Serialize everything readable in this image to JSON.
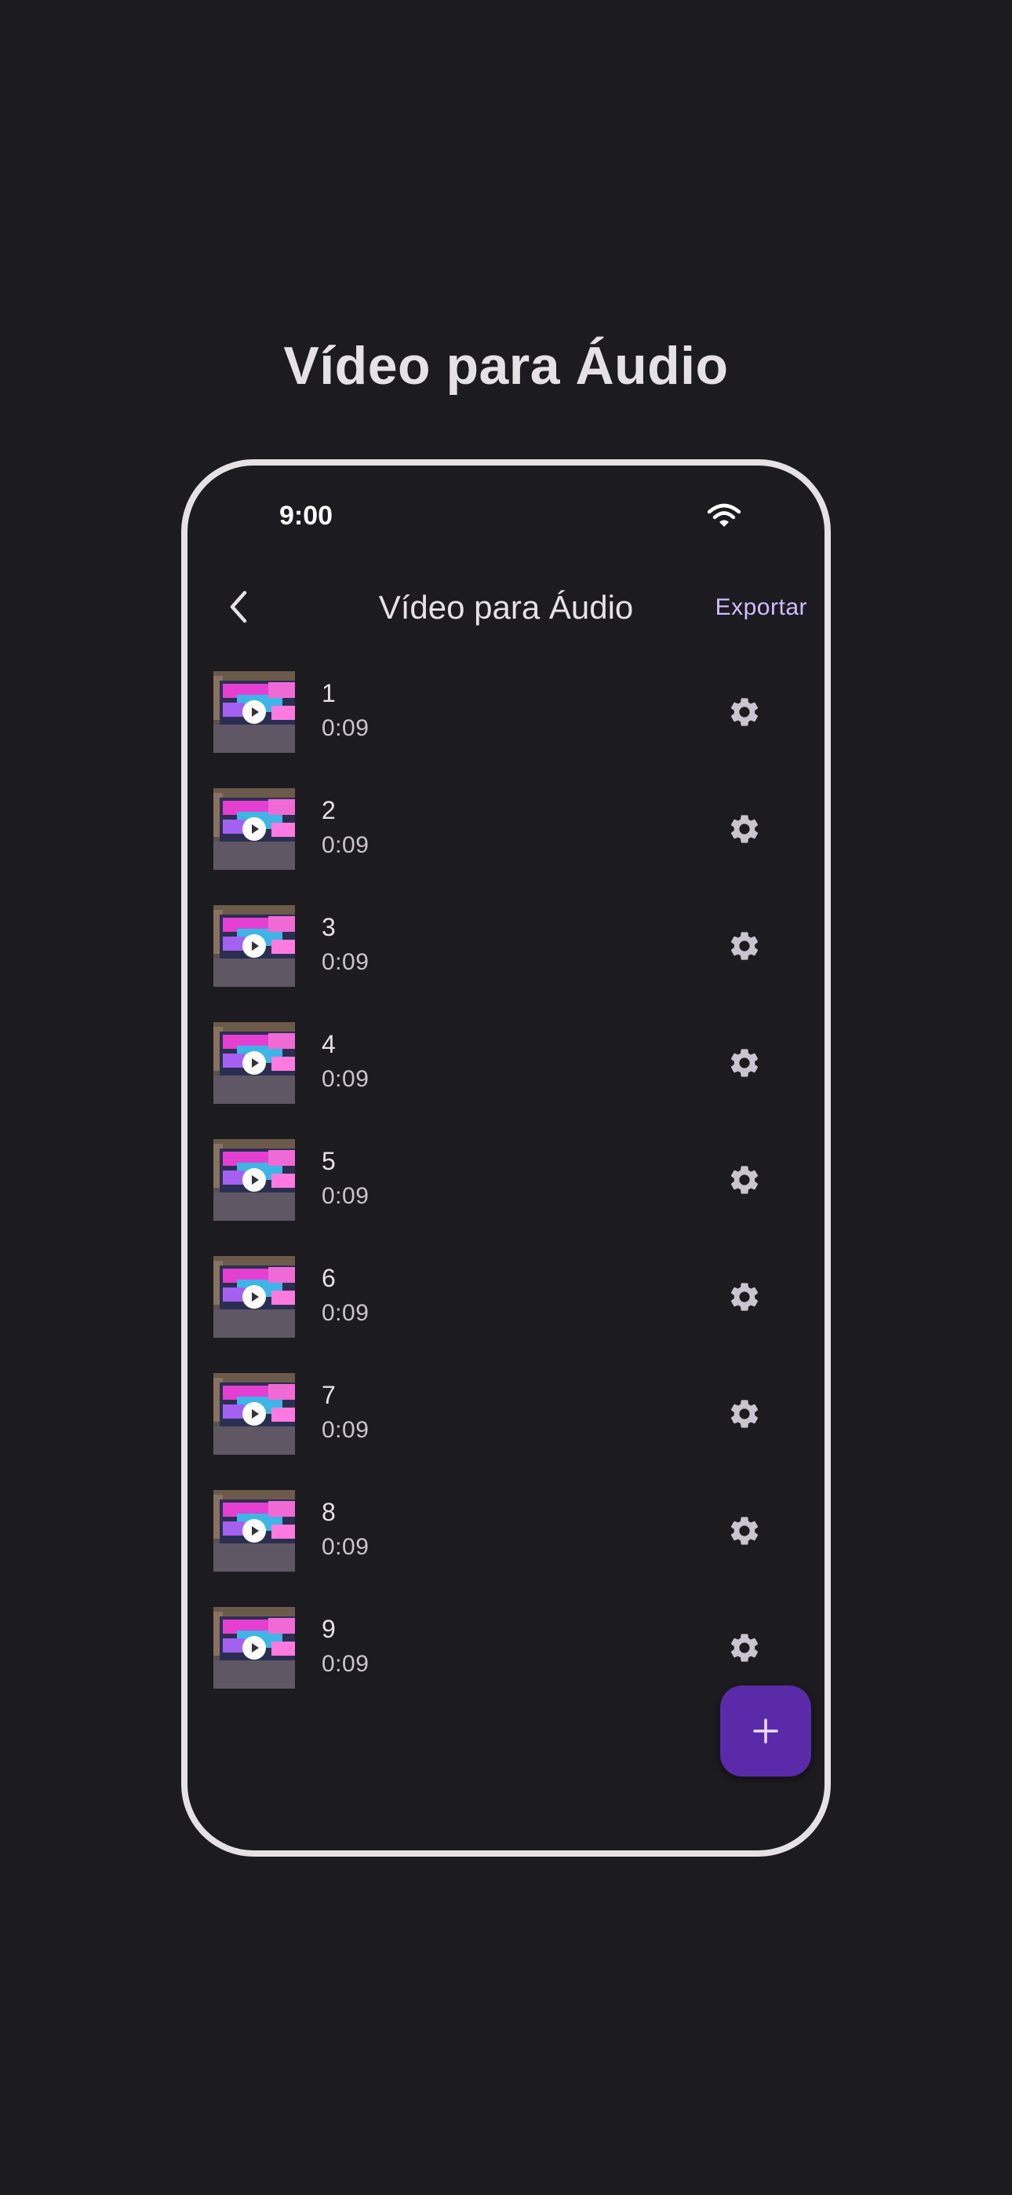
{
  "headline": "Vídeo para Áudio",
  "status_bar": {
    "time": "9:00",
    "wifi_icon": "wifi-icon"
  },
  "app_bar": {
    "back_icon": "chevron-left-icon",
    "title": "Vídeo para Áudio",
    "export_label": "Exportar"
  },
  "items": [
    {
      "title": "1",
      "duration": "0:09"
    },
    {
      "title": "2",
      "duration": "0:09"
    },
    {
      "title": "3",
      "duration": "0:09"
    },
    {
      "title": "4",
      "duration": "0:09"
    },
    {
      "title": "5",
      "duration": "0:09"
    },
    {
      "title": "6",
      "duration": "0:09"
    },
    {
      "title": "7",
      "duration": "0:09"
    },
    {
      "title": "8",
      "duration": "0:09"
    },
    {
      "title": "9",
      "duration": "0:09"
    }
  ],
  "item_icons": {
    "thumbnail": "video-thumbnail",
    "play": "play-icon",
    "settings": "gear-icon"
  },
  "fab": {
    "icon": "plus-icon"
  },
  "colors": {
    "background": "#1c1b1f",
    "accent": "#d0bcff",
    "fab": "#5b2aa8",
    "text": "#e6e1e5",
    "secondary_text": "#cac4d0"
  }
}
